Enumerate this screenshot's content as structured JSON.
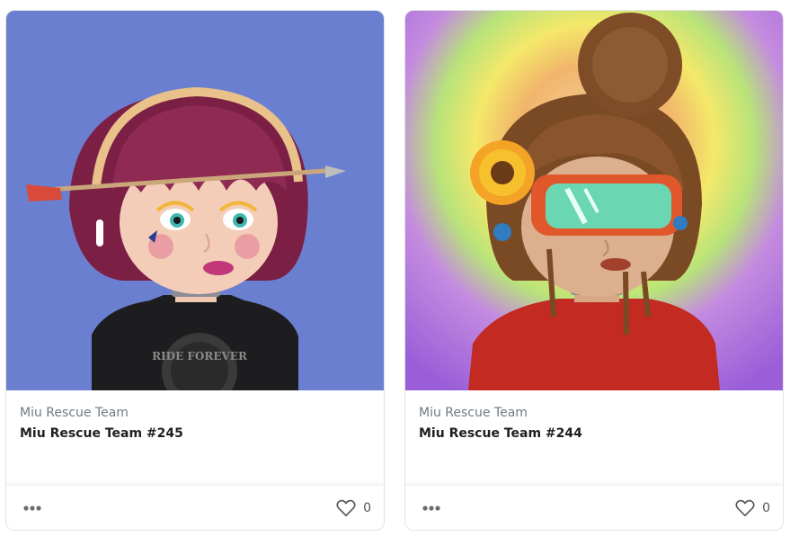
{
  "cards": [
    {
      "collection": "Miu Rescue Team",
      "title": "Miu Rescue Team #245",
      "likes": "0",
      "image_alt": "Girl with magenta bob, headband, arrow through head, black 'Ride Forever' shirt on blue background",
      "shirt_text": "RIDE FOREVER",
      "accent": "#6b7fd0"
    },
    {
      "collection": "Miu Rescue Team",
      "title": "Miu Rescue Team #244",
      "likes": "0",
      "image_alt": "Girl with brown bun, sunflower, orange goggles, red fuzzy sweater on rainbow background",
      "accent": "#f0c96a"
    }
  ],
  "icons": {
    "more": "more-dots-icon",
    "like": "heart-outline-icon"
  }
}
